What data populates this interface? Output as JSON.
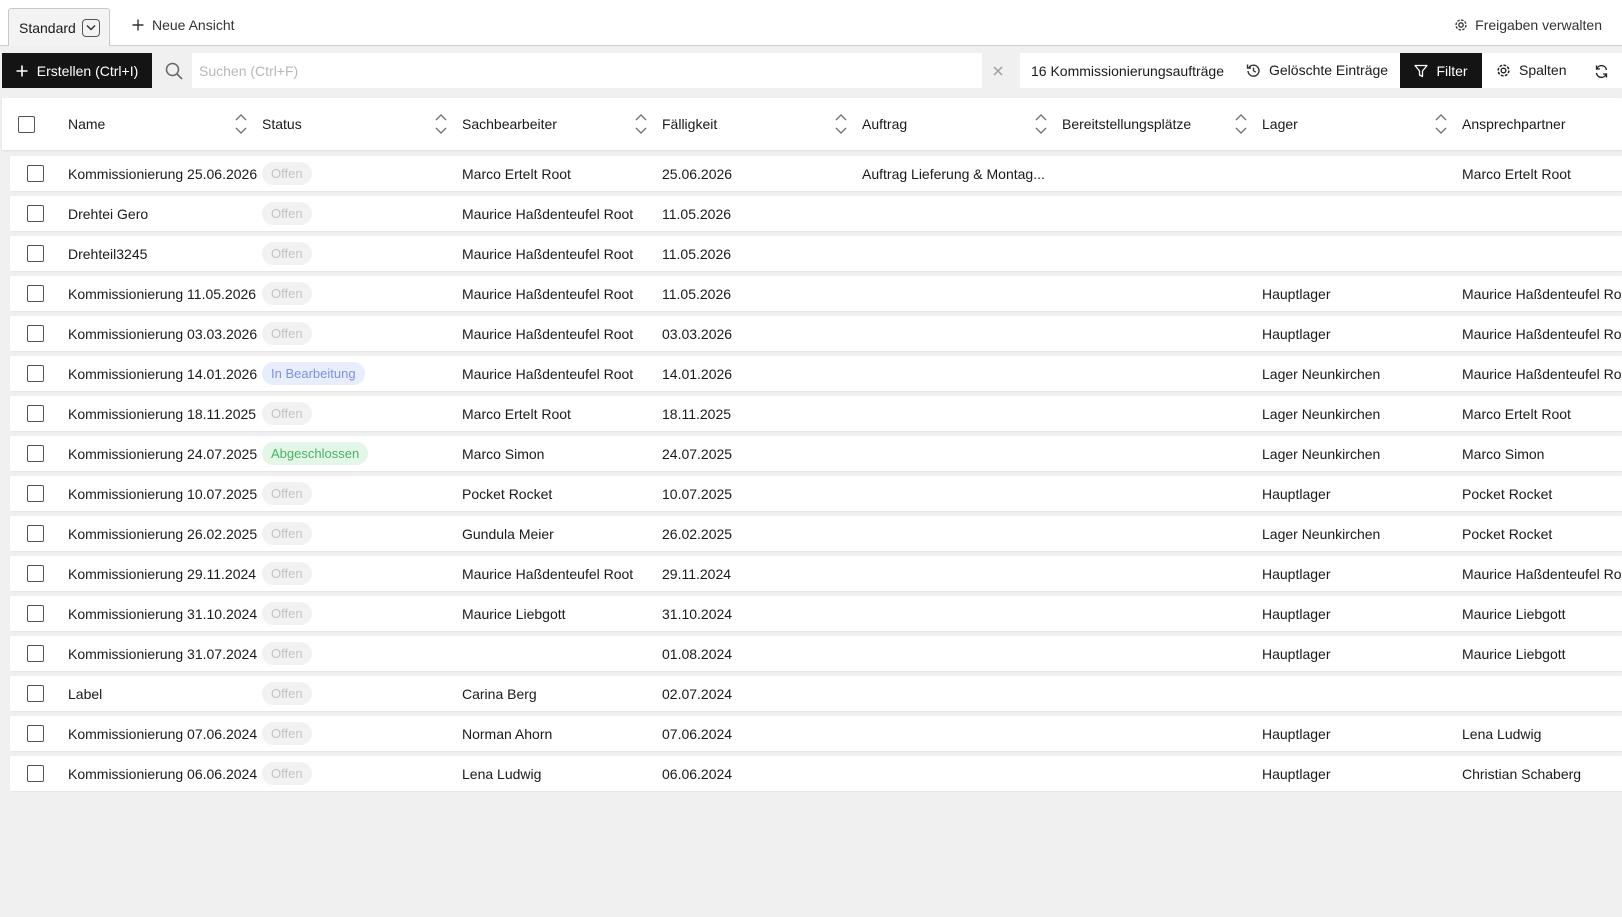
{
  "viewbar": {
    "active_view": "Standard",
    "new_view_label": "Neue Ansicht",
    "share_label": "Freigaben verwalten"
  },
  "toolbar": {
    "create_label": "Erstellen (Ctrl+I)",
    "search_placeholder": "Suchen (Ctrl+F)",
    "search_value": "",
    "count_label": "16 Kommissionierungsaufträge",
    "deleted_label": "Gelöschte Einträge",
    "filter_label": "Filter",
    "columns_label": "Spalten"
  },
  "columns": [
    "Name",
    "Status",
    "Sachbearbeiter",
    "Fälligkeit",
    "Auftrag",
    "Bereitstellungsplätze",
    "Lager",
    "Ansprechpartner"
  ],
  "rows": [
    {
      "name": "Kommissionierung 25.06.2026",
      "status": "Offen",
      "clerk": "Marco Ertelt Root",
      "due": "25.06.2026",
      "order": "Auftrag Lieferung & Montag...",
      "slots": "",
      "warehouse": "",
      "contact": "Marco Ertelt Root"
    },
    {
      "name": "Drehtei Gero",
      "status": "Offen",
      "clerk": "Maurice Haßdenteufel Root",
      "due": "11.05.2026",
      "order": "",
      "slots": "",
      "warehouse": "",
      "contact": ""
    },
    {
      "name": "Drehteil3245",
      "status": "Offen",
      "clerk": "Maurice Haßdenteufel Root",
      "due": "11.05.2026",
      "order": "",
      "slots": "",
      "warehouse": "",
      "contact": ""
    },
    {
      "name": "Kommissionierung 11.05.2026",
      "status": "Offen",
      "clerk": "Maurice Haßdenteufel Root",
      "due": "11.05.2026",
      "order": "",
      "slots": "",
      "warehouse": "Hauptlager",
      "contact": "Maurice Haßdenteufel Ro"
    },
    {
      "name": "Kommissionierung 03.03.2026",
      "status": "Offen",
      "clerk": "Maurice Haßdenteufel Root",
      "due": "03.03.2026",
      "order": "",
      "slots": "",
      "warehouse": "Hauptlager",
      "contact": "Maurice Haßdenteufel Ro"
    },
    {
      "name": "Kommissionierung 14.01.2026",
      "status": "In Bearbeitung",
      "clerk": "Maurice Haßdenteufel Root",
      "due": "14.01.2026",
      "order": "",
      "slots": "",
      "warehouse": "Lager Neunkirchen",
      "contact": "Maurice Haßdenteufel Ro"
    },
    {
      "name": "Kommissionierung 18.11.2025",
      "status": "Offen",
      "clerk": "Marco Ertelt Root",
      "due": "18.11.2025",
      "order": "",
      "slots": "",
      "warehouse": "Lager Neunkirchen",
      "contact": "Marco Ertelt Root"
    },
    {
      "name": "Kommissionierung 24.07.2025",
      "status": "Abgeschlossen",
      "clerk": "Marco Simon",
      "due": "24.07.2025",
      "order": "",
      "slots": "",
      "warehouse": "Lager Neunkirchen",
      "contact": "Marco Simon"
    },
    {
      "name": "Kommissionierung 10.07.2025",
      "status": "Offen",
      "clerk": "Pocket Rocket",
      "due": "10.07.2025",
      "order": "",
      "slots": "",
      "warehouse": "Hauptlager",
      "contact": "Pocket Rocket"
    },
    {
      "name": "Kommissionierung 26.02.2025",
      "status": "Offen",
      "clerk": "Gundula Meier",
      "due": "26.02.2025",
      "order": "",
      "slots": "",
      "warehouse": "Lager Neunkirchen",
      "contact": "Pocket Rocket"
    },
    {
      "name": "Kommissionierung 29.11.2024",
      "status": "Offen",
      "clerk": "Maurice Haßdenteufel Root",
      "due": "29.11.2024",
      "order": "",
      "slots": "",
      "warehouse": "Hauptlager",
      "contact": "Maurice Haßdenteufel Ro"
    },
    {
      "name": "Kommissionierung 31.10.2024",
      "status": "Offen",
      "clerk": "Maurice Liebgott",
      "due": "31.10.2024",
      "order": "",
      "slots": "",
      "warehouse": "Hauptlager",
      "contact": "Maurice Liebgott"
    },
    {
      "name": "Kommissionierung 31.07.2024",
      "status": "Offen",
      "clerk": "",
      "due": "01.08.2024",
      "order": "",
      "slots": "",
      "warehouse": "Hauptlager",
      "contact": "Maurice Liebgott"
    },
    {
      "name": "Label",
      "status": "Offen",
      "clerk": "Carina Berg",
      "due": "02.07.2024",
      "order": "",
      "slots": "",
      "warehouse": "",
      "contact": ""
    },
    {
      "name": "Kommissionierung 07.06.2024",
      "status": "Offen",
      "clerk": "Norman Ahorn",
      "due": "07.06.2024",
      "order": "",
      "slots": "",
      "warehouse": "Hauptlager",
      "contact": "Lena Ludwig"
    },
    {
      "name": "Kommissionierung 06.06.2024",
      "status": "Offen",
      "clerk": "Lena Ludwig",
      "due": "06.06.2024",
      "order": "",
      "slots": "",
      "warehouse": "Hauptlager",
      "contact": "Christian Schaberg"
    }
  ],
  "status_colors": {
    "Offen": "#c4c4c4",
    "In Bearbeitung": "#7d93dd",
    "Abgeschlossen": "#48b363"
  },
  "icons": {
    "view_dropdown": "chevron-down-icon",
    "new_view": "plus-icon",
    "share": "gear-icon",
    "create": "plus-icon",
    "search": "search-icon",
    "clear": "close-icon",
    "deleted": "restore-icon",
    "filter": "funnel-icon",
    "columns": "gear-icon",
    "refresh": "refresh-icon",
    "sort": "sort-icon"
  }
}
